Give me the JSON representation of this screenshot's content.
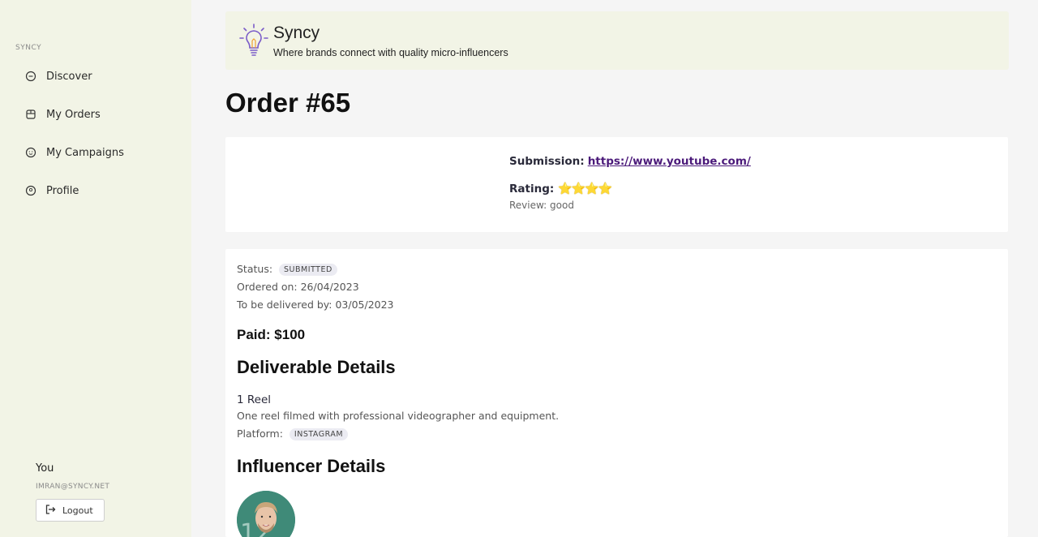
{
  "sidebar": {
    "brand": "SYNCY",
    "items": [
      {
        "label": "Discover",
        "icon": "chat-bubble-icon"
      },
      {
        "label": "My Orders",
        "icon": "storefront-icon"
      },
      {
        "label": "My Campaigns",
        "icon": "smiley-icon"
      },
      {
        "label": "Profile",
        "icon": "user-circle-icon"
      }
    ],
    "user": {
      "name": "You",
      "email": "IMRAN@SYNCY.NET",
      "logout_label": "Logout"
    }
  },
  "banner": {
    "title": "Syncy",
    "subtitle": "Where brands connect with quality micro-influencers",
    "logo_icon": "lightbulb-icon"
  },
  "order": {
    "title": "Order #65",
    "submission_label": "Submission:",
    "submission_url": "https://www.youtube.com/",
    "rating_label": "Rating:",
    "rating_stars": "⭐⭐⭐⭐",
    "review_text": "Review: good",
    "status_label": "Status:",
    "status_value": "SUBMITTED",
    "ordered_on": "Ordered on: 26/04/2023",
    "delivered_by": "To be delivered by: 03/05/2023",
    "paid": "Paid: $100",
    "deliverable_heading": "Deliverable Details",
    "deliverable_name": "1 Reel",
    "deliverable_desc": "One reel filmed with professional videographer and equipment.",
    "platform_label": "Platform:",
    "platform_value": "INSTAGRAM",
    "influencer_heading": "Influencer Details"
  },
  "colors": {
    "sidebar_bg": "#f2f4e6",
    "link": "#4b1a7a",
    "star": "#f2c531",
    "avatar_bg": "#3f8a78"
  }
}
